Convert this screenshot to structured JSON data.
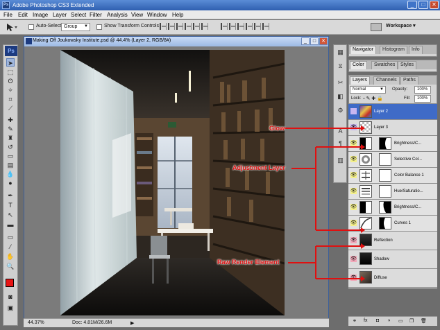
{
  "window": {
    "title": "Adobe Photoshop CS3 Extended",
    "min": "_",
    "max": "□",
    "close": "✕"
  },
  "menu": [
    "File",
    "Edit",
    "Image",
    "Layer",
    "Select",
    "Filter",
    "Analysis",
    "View",
    "Window",
    "Help"
  ],
  "options": {
    "auto_select_label": "Auto-Select:",
    "auto_select_value": "Group",
    "show_transform_label": "Show Transform Controls",
    "workspace_label": "Workspace ▾"
  },
  "toolbox": {
    "logo": "Ps"
  },
  "document": {
    "title": "Making Off Joukowsky Institute.psd @ 44.4% (Layer 2, RGB/8#)",
    "zoom": "44.37%",
    "doc_size": "Doc: 4.81M/26.6M"
  },
  "panels": {
    "nav_tabs": [
      "Navigator",
      "Histogram",
      "Info"
    ],
    "color_tabs": [
      "Color",
      "Swatches",
      "Styles"
    ],
    "layer_tabs": [
      "Layers",
      "Channels",
      "Paths"
    ],
    "blend_mode": "Normal",
    "opacity_label": "Opacity:",
    "opacity_value": "100%",
    "lock_label": "Lock:",
    "fill_label": "Fill:",
    "fill_value": "100%"
  },
  "layers": [
    {
      "name": "Layer 2",
      "row_color": "#c8b6f0",
      "selected": true
    },
    {
      "name": "Layer 3",
      "row_color": "#c8b6f0",
      "selected": false
    },
    {
      "name": "Brightness/C...",
      "row_color": "#f4f08a",
      "selected": false
    },
    {
      "name": "Selective Col...",
      "row_color": "#f4f08a",
      "selected": false
    },
    {
      "name": "Color Balance 1",
      "row_color": "#f4f08a",
      "selected": false
    },
    {
      "name": "Hue/Saturatio...",
      "row_color": "#f4f08a",
      "selected": false
    },
    {
      "name": "Brightness/C...",
      "row_color": "#f4f08a",
      "selected": false
    },
    {
      "name": "Curves 1",
      "row_color": "#f4f08a",
      "selected": false
    },
    {
      "name": "Reflection",
      "row_color": "#f2a7b8",
      "selected": false
    },
    {
      "name": "Shadow",
      "row_color": "#f2a7b8",
      "selected": false
    },
    {
      "name": "Diffuse",
      "row_color": "#f2a7b8",
      "selected": false
    }
  ],
  "annotations": {
    "glow": "Glow",
    "adjustment": "Adjustment Layer",
    "raw": "Raw Render Element",
    "color": "#e01010"
  },
  "layer_bottom_icons": [
    "link-icon",
    "fx-icon",
    "mask-icon",
    "adjustment-icon",
    "folder-icon",
    "new-layer-icon",
    "trash-icon"
  ]
}
